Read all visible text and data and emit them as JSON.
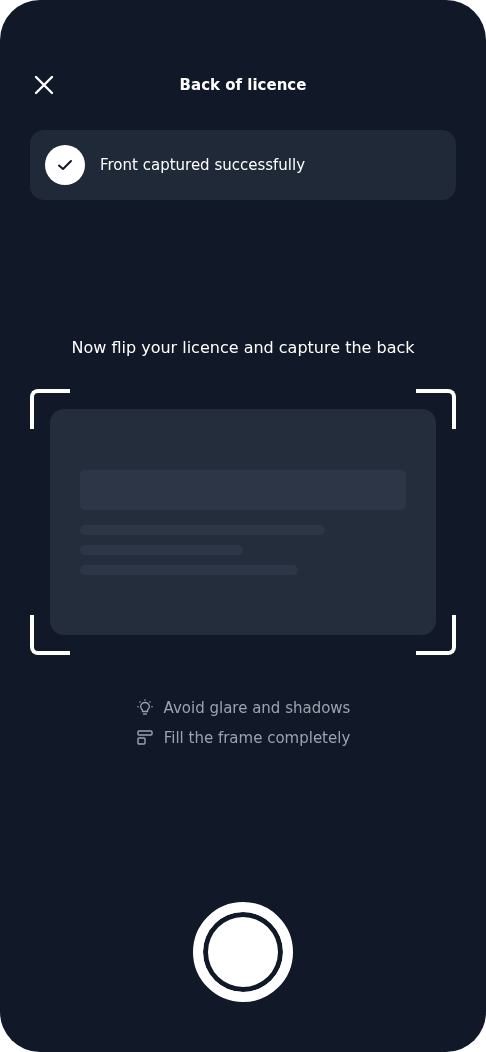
{
  "header": {
    "title": "Back of licence"
  },
  "status": {
    "text": "Front captured successfully",
    "success": true
  },
  "instruction": "Now flip your licence and capture the back",
  "tips": [
    {
      "kind": "light",
      "text": "Avoid glare and shadows"
    },
    {
      "kind": "frame",
      "text": "Fill the frame completely"
    }
  ]
}
